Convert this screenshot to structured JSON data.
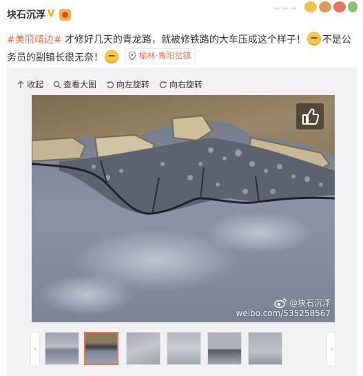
{
  "post": {
    "username": "块石沉浮",
    "hashtag": "#美丽靖边#",
    "text_part1": " 才修好几天的青龙路，就被修铁路的大车压成这个样子！",
    "text_part2": "不是公务员的副镇长很无奈！",
    "location": "榆林·青阳岔镇"
  },
  "toolbar": {
    "collapse": "收起",
    "view_large": "查看大图",
    "rotate_left": "向左旋转",
    "rotate_right": "向右旋转"
  },
  "watermark": {
    "name": "@块石沉浮",
    "url": "weibo.com/535258567"
  },
  "thumbnails": {
    "count": 6,
    "active_index": 1
  },
  "colors": {
    "accent": "#eb7350",
    "username": "#333333",
    "media_bg": "#f2f2f5"
  }
}
